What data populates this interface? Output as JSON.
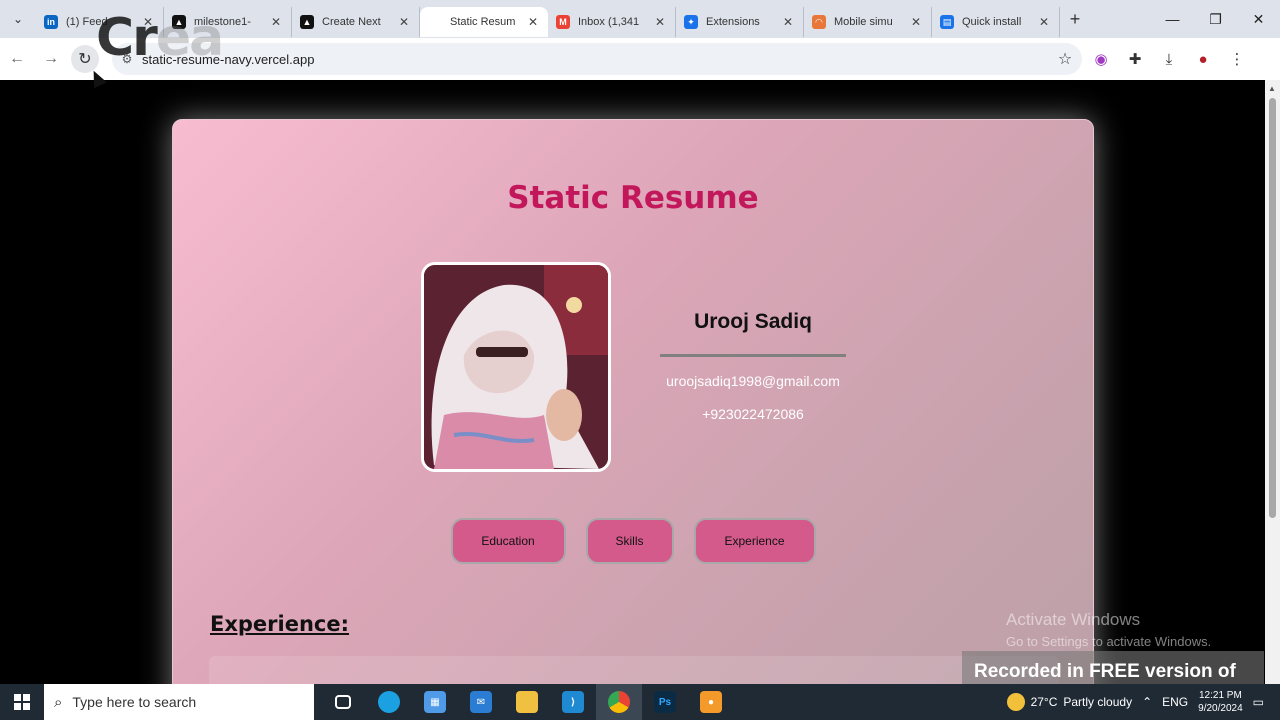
{
  "browser": {
    "tabs": [
      {
        "label": "(1) Feed",
        "color": "#0a66c2",
        "icon_text": "in",
        "active": false
      },
      {
        "label": "milestone1-",
        "color": "#111111",
        "icon_text": "▲",
        "active": false
      },
      {
        "label": "Create Next",
        "color": "#111111",
        "icon_text": "▲",
        "active": false
      },
      {
        "label": "Static Resum",
        "color": "",
        "icon_text": "",
        "active": true
      },
      {
        "label": "Inbox (1,341",
        "color": "#ea4335",
        "icon_text": "M",
        "active": false
      },
      {
        "label": "Extensions",
        "color": "#1a73e8",
        "icon_text": "✦",
        "active": false
      },
      {
        "label": "Mobile simu",
        "color": "#e8773a",
        "icon_text": "◠",
        "active": false
      },
      {
        "label": "Quick install",
        "color": "#1a73e8",
        "icon_text": "▤",
        "active": false
      }
    ],
    "url": "static-resume-navy.vercel.app"
  },
  "resume": {
    "title": "Static Resume",
    "name": "Urooj Sadiq",
    "email": "uroojsadiq1998@gmail.com",
    "phone": "+923022472086",
    "buttons": {
      "education": "Education",
      "skills": "Skills",
      "experience": "Experience"
    },
    "section_title": "Experience:"
  },
  "overlays": {
    "activate_title": "Activate Windows",
    "activate_sub": "Go to Settings to activate Windows.",
    "watermark": "Recorded in FREE version of Icecream  Screen  Recorder",
    "logo_dark": "Cr",
    "logo_faint": "ea"
  },
  "taskbar": {
    "search_placeholder": "Type here to search",
    "weather_temp": "27°C",
    "weather_desc": "Partly cloudy",
    "lang": "ENG",
    "time": "12:21 PM",
    "date": "9/20/2024"
  },
  "colors": {
    "title": "#c2185b",
    "button": "#d45a8c"
  }
}
